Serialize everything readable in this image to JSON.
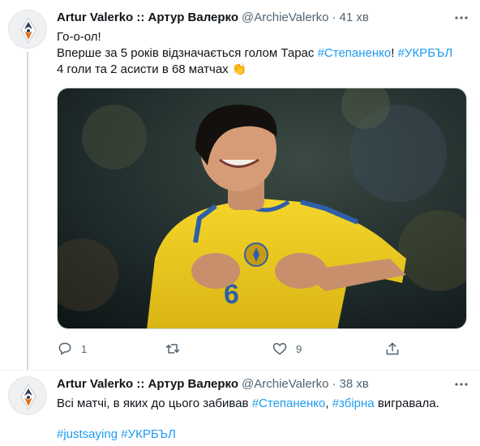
{
  "tweets": [
    {
      "author_name": "Artur Valerko :: Артур Валерко",
      "handle": "@ArchieValerko",
      "separator": "·",
      "time": "41 хв",
      "line1": "Го-о-ол!",
      "line2_prefix": "Вперше за 5 років відзначається голом Тарас ",
      "line2_link1": "#Степаненко",
      "line2_mid": "! ",
      "line2_link2": "#УКРБЪЛ",
      "line3_text": "4 голи та 2 асисти в 68 матчах",
      "line3_emoji": "👏",
      "reply_count": "1",
      "retweet_count": "",
      "like_count": "9"
    },
    {
      "author_name": "Artur Valerko :: Артур Валерко",
      "handle": "@ArchieValerko",
      "separator": "·",
      "time": "38 хв",
      "line1_prefix": "Всі матчі, в яких до цього забивав ",
      "line1_link1": "#Степаненко",
      "line1_sep": ", ",
      "line1_link2": "#збірна",
      "line1_suffix": " вигравала.",
      "tag1": "#justsaying",
      "tag2": "#УКРБЪЛ"
    }
  ],
  "colors": {
    "link": "#1d9bf0",
    "secondary_text": "#536471",
    "kit_yellow": "#f2cf1d",
    "kit_blue": "#2f5fa8"
  },
  "icons": [
    "avatar-logo",
    "more-icon",
    "reply-icon",
    "retweet-icon",
    "like-icon",
    "share-icon"
  ]
}
